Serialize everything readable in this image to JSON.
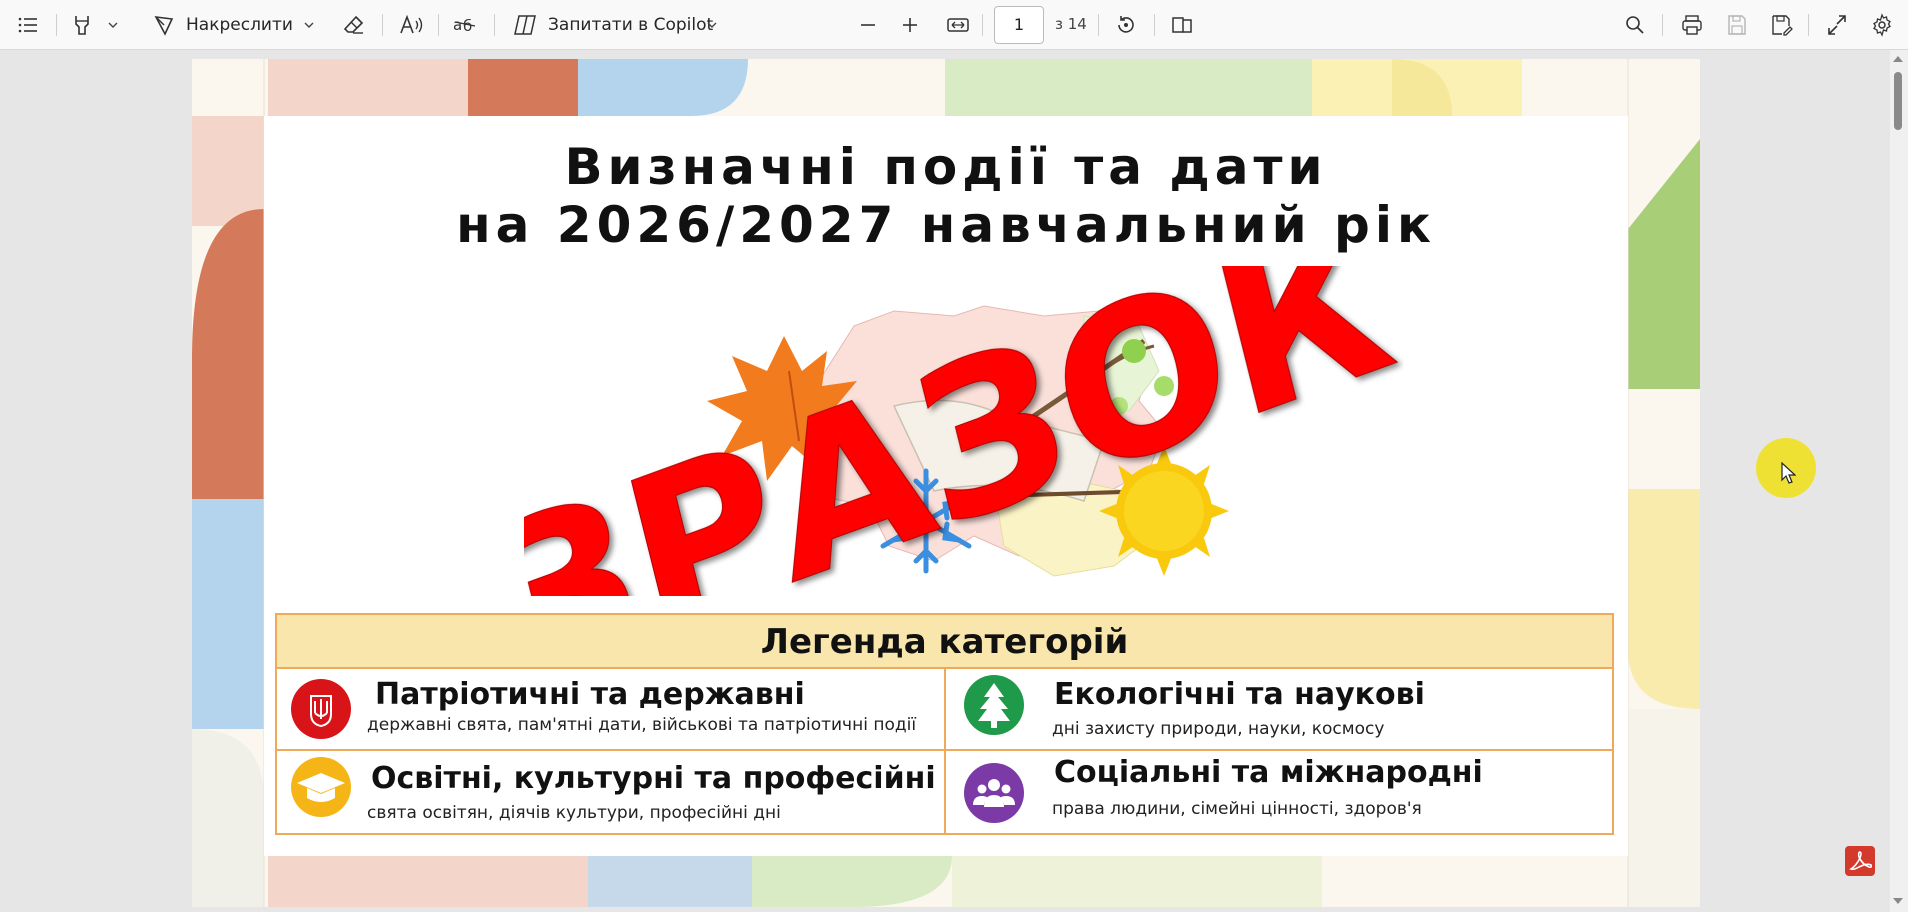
{
  "toolbar": {
    "draw_label": "Накреслити",
    "copilot_label": "Запитати в Copilot",
    "page_current": "1",
    "page_of": "з 14",
    "icons": [
      "contents-icon",
      "highlight-icon",
      "chevron-down-icon",
      "draw-icon",
      "eraser-icon",
      "read-aloud-icon",
      "translate-icon",
      "copilot-icon",
      "zoom-out-icon",
      "zoom-in-icon",
      "fit-width-icon",
      "rotate-icon",
      "page-view-icon",
      "search-icon",
      "print-icon",
      "save-icon",
      "save-as-icon",
      "fullscreen-icon",
      "settings-icon"
    ]
  },
  "document": {
    "title_line1": "Визначні події та дати",
    "title_line2": "на 2026/2027 навчальний рік",
    "watermark": "ЗРАЗОК",
    "legend": {
      "heading": "Легенда категорій",
      "items": [
        {
          "title": "Патріотичні та державні",
          "desc": "державні свята, пам'ятні дати, військові та патріотичні події",
          "color": "#d81418",
          "icon": "trident-icon"
        },
        {
          "title": "Екологічні та наукові",
          "desc": "дні захисту природи, науки, космосу",
          "color": "#1f9a4a",
          "icon": "tree-icon"
        },
        {
          "title": "Освітні, культурні та професійні",
          "desc": "свята освітян, діячів культури, професійні дні",
          "color": "#f5b516",
          "icon": "graduation-cap-icon"
        },
        {
          "title": "Соціальні та міжнародні",
          "desc": "права людини, сімейні цінності, здоров'я",
          "color": "#7b3aa6",
          "icon": "people-icon"
        }
      ]
    }
  },
  "colors": {
    "accent_border": "#f0a85a",
    "legend_header_bg": "#f8e6ad",
    "watermark_red": "#ff0000"
  }
}
